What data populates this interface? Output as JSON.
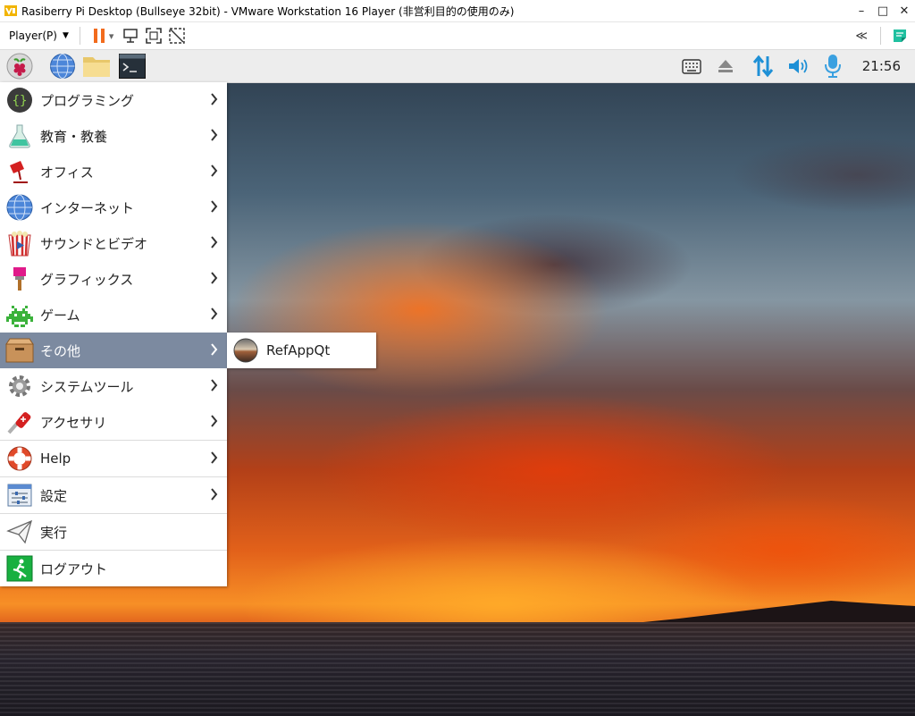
{
  "window": {
    "title": "Rasiberry Pi Desktop (Bullseye 32bit) - VMware Workstation 16 Player (非営利目的の使用のみ)",
    "controls": {
      "minimize": "–",
      "maximize": "□",
      "close": "✕"
    }
  },
  "vm_toolbar": {
    "player_menu": "Player(P)",
    "pause_dropdown": "▾",
    "right_collapse": "≪",
    "icons": [
      "pause-icon",
      "send-ctrl-alt-del-icon",
      "fullscreen-icon",
      "unity-icon",
      "collapse-icon",
      "notes-icon"
    ]
  },
  "panel": {
    "launchers": [
      "raspberry-menu-icon",
      "web-browser-icon",
      "file-manager-icon",
      "terminal-icon"
    ],
    "tray": [
      "keyboard-icon",
      "eject-icon",
      "network-icon",
      "volume-icon",
      "microphone-icon"
    ],
    "clock": "21:56"
  },
  "menu": {
    "items": [
      {
        "label": "プログラミング",
        "icon": "programming-icon",
        "has_submenu": true
      },
      {
        "label": "教育・教養",
        "icon": "education-icon",
        "has_submenu": true
      },
      {
        "label": "オフィス",
        "icon": "office-icon",
        "has_submenu": true
      },
      {
        "label": "インターネット",
        "icon": "internet-icon",
        "has_submenu": true
      },
      {
        "label": "サウンドとビデオ",
        "icon": "sound-video-icon",
        "has_submenu": true
      },
      {
        "label": "グラフィックス",
        "icon": "graphics-icon",
        "has_submenu": true
      },
      {
        "label": "ゲーム",
        "icon": "games-icon",
        "has_submenu": true
      },
      {
        "label": "その他",
        "icon": "other-icon",
        "has_submenu": true,
        "active": true
      },
      {
        "label": "システムツール",
        "icon": "system-tools-icon",
        "has_submenu": true
      },
      {
        "label": "アクセサリ",
        "icon": "accessories-icon",
        "has_submenu": true
      },
      {
        "label": "Help",
        "icon": "help-icon",
        "has_submenu": true
      },
      {
        "label": "設定",
        "icon": "settings-icon",
        "has_submenu": true
      },
      {
        "label": "実行",
        "icon": "run-icon",
        "has_submenu": false
      },
      {
        "label": "ログアウト",
        "icon": "logout-icon",
        "has_submenu": false
      }
    ]
  },
  "submenu": {
    "items": [
      {
        "label": "RefAppQt",
        "icon": "refappqt-icon"
      }
    ]
  },
  "colors": {
    "menu_active": "#7c8aa0",
    "panel_bg": "#ededed",
    "accent_blue": "#1e90d6"
  }
}
